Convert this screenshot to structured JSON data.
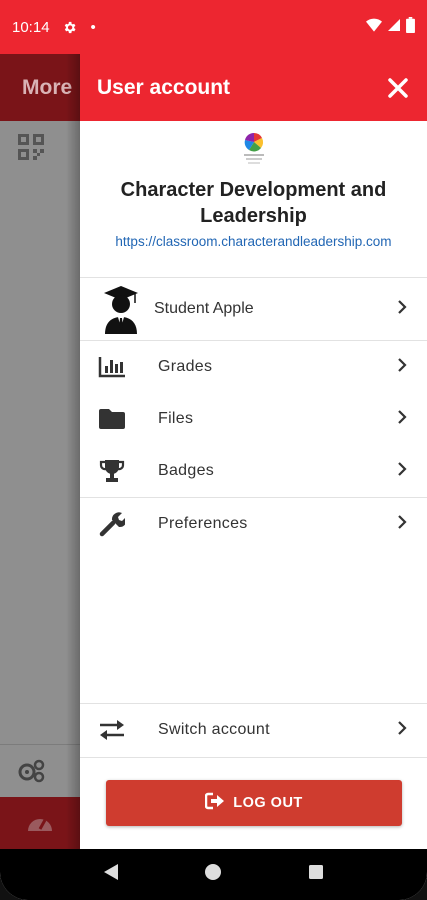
{
  "status_bar": {
    "time": "10:14",
    "dot": "•",
    "icons": [
      "settings-icon",
      "wifi-icon",
      "signal-icon",
      "battery-icon"
    ]
  },
  "background_app": {
    "header_title": "More",
    "icons": [
      "qr-code-icon",
      "settings-gears-icon",
      "dashboard-icon"
    ]
  },
  "drawer": {
    "title": "User account",
    "site": {
      "name": "Character Development and Leadership",
      "url": "https://classroom.characterandleadership.com"
    },
    "user": {
      "name": "Student Apple"
    },
    "menu": [
      {
        "label": "Grades",
        "icon": "grades-chart-icon"
      },
      {
        "label": "Files",
        "icon": "folder-icon"
      },
      {
        "label": "Badges",
        "icon": "trophy-icon"
      },
      {
        "label": "Preferences",
        "icon": "wrench-icon"
      }
    ],
    "switch_account": "Switch account",
    "logout": "LOG OUT"
  },
  "colors": {
    "accent": "#ed2630",
    "logout_button": "#cf3c2f",
    "link": "#2166b4"
  },
  "nav_bar": {
    "buttons": [
      "back-icon",
      "home-icon",
      "recents-icon"
    ]
  }
}
